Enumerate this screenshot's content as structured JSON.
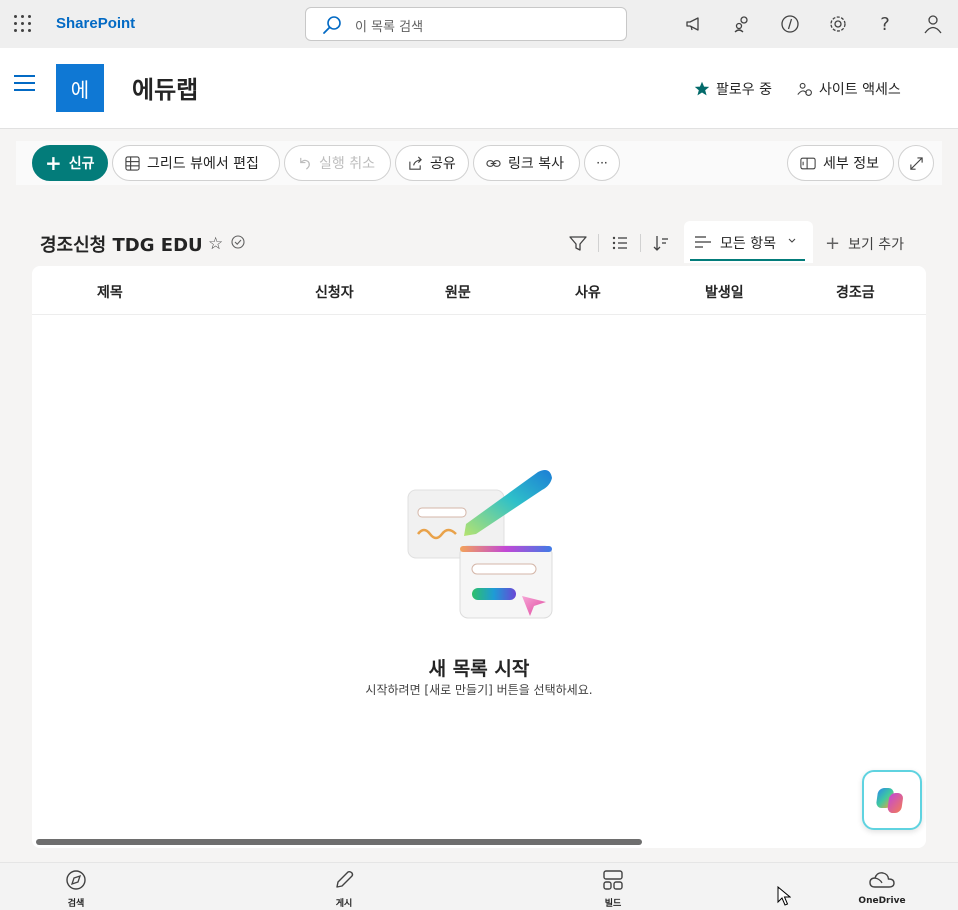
{
  "suitebar": {
    "brand": "SharePoint",
    "search_placeholder": "이 목록 검색",
    "icons": [
      "app-launcher-icon",
      "megaphone-icon",
      "people-network-icon",
      "code-icon",
      "gear-icon",
      "help-icon",
      "person-icon"
    ]
  },
  "site": {
    "logo_text": "에",
    "title": "에듀랩",
    "follow_label": "팔로우 중",
    "access_label": "사이트 액세스"
  },
  "commandbar": {
    "new_label": "신규",
    "grid_edit_label": "그리드 뷰에서 편집",
    "undo_label": "실행 취소",
    "share_label": "공유",
    "copy_link_label": "링크 복사",
    "more_label": "···",
    "details_label": "세부 정보"
  },
  "list": {
    "title": "경조신청 TDG EDU",
    "view_name": "모든 항목",
    "add_view_label": "보기 추가",
    "columns": [
      "제목",
      "신청자",
      "원문",
      "사유",
      "발생일",
      "경조금"
    ],
    "empty_title": "새 목록 시작",
    "empty_subtitle": "시작하려면 [새로 만들기] 버튼을 선택하세요."
  },
  "appbar": {
    "items": [
      {
        "label": "검색",
        "icon": "compass-icon"
      },
      {
        "label": "게시",
        "icon": "pen-icon"
      },
      {
        "label": "빌드",
        "icon": "layout-icon"
      },
      {
        "label": "OneDrive",
        "icon": "cloud-icon"
      }
    ]
  },
  "colors": {
    "brand_blue": "#036ac4",
    "accent_teal": "#037c7a",
    "site_logo_bg": "#0f78d4"
  }
}
